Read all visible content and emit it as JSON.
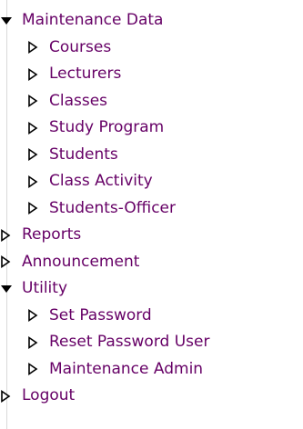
{
  "menu": {
    "maintenance_data": {
      "label": "Maintenance Data",
      "expanded": true,
      "children": {
        "courses": "Courses",
        "lecturers": "Lecturers",
        "classes": "Classes",
        "study_program": "Study Program",
        "students": "Students",
        "class_activity": "Class Activity",
        "students_officer": "Students-Officer"
      }
    },
    "reports": {
      "label": "Reports",
      "expanded": false
    },
    "announcement": {
      "label": "Announcement",
      "expanded": false
    },
    "utility": {
      "label": "Utility",
      "expanded": true,
      "children": {
        "set_password": "Set Password",
        "reset_password_user": "Reset Password User",
        "maintenance_admin": "Maintenance Admin"
      }
    },
    "logout": {
      "label": "Logout",
      "expanded": false
    }
  },
  "colors": {
    "link": "#660066",
    "arrow": "#000000"
  },
  "icons": {
    "expanded": "triangle-down-filled-icon",
    "collapsed": "triangle-right-outline-icon"
  }
}
